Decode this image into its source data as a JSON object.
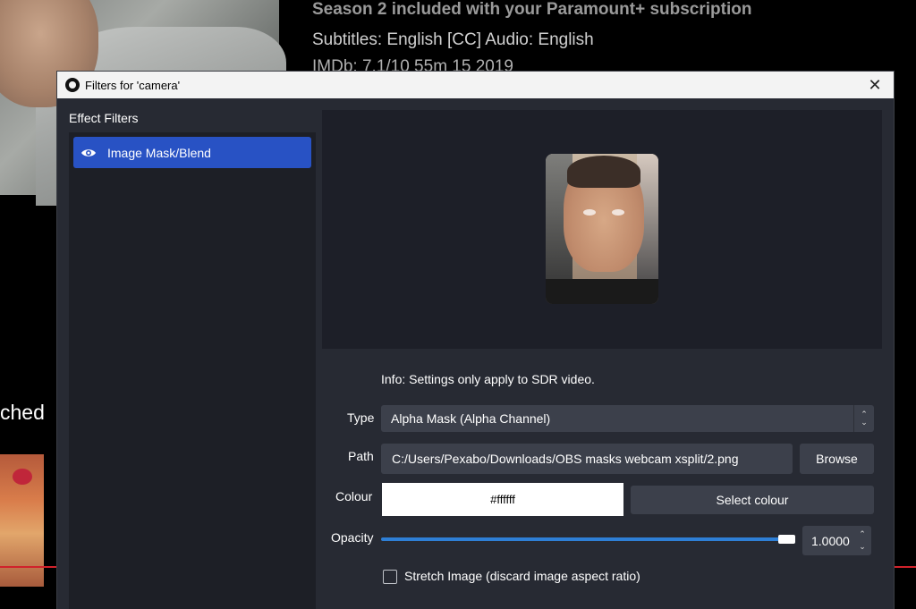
{
  "background": {
    "line1": "Season 2 included with your Paramount+ subscription",
    "line2": "Subtitles: English [CC]    Audio: English",
    "line3": "IMDb: 7.1/10  55m  15  2019",
    "partial_word": "ched"
  },
  "dialog": {
    "title": "Filters for 'camera'",
    "close_glyph": "✕",
    "effect_filters_label": "Effect Filters",
    "filters": [
      {
        "label": "Image Mask/Blend",
        "icon": "eye-icon",
        "selected": true
      }
    ],
    "info_text": "Info: Settings only apply to SDR video.",
    "type": {
      "label": "Type",
      "value": "Alpha Mask (Alpha Channel)"
    },
    "path": {
      "label": "Path",
      "value": "C:/Users/Pexabo/Downloads/OBS masks webcam xsplit/2.png",
      "browse_label": "Browse"
    },
    "colour": {
      "label": "Colour",
      "value": "#ffffff",
      "select_label": "Select colour"
    },
    "opacity": {
      "label": "Opacity",
      "value": "1.0000",
      "fraction": 1.0
    },
    "stretch": {
      "label": "Stretch Image (discard image aspect ratio)",
      "checked": false
    },
    "accent_color": "#2852c4"
  }
}
